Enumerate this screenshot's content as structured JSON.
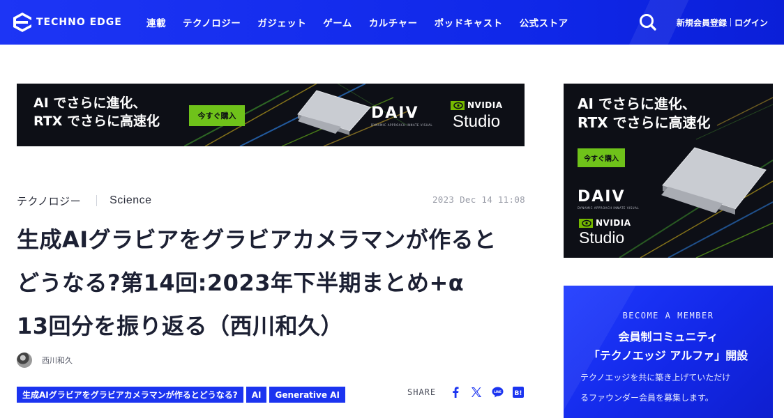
{
  "header": {
    "logo_text": "TECHNO EDGE",
    "nav": [
      "連載",
      "テクノロジー",
      "ガジェット",
      "ゲーム",
      "カルチャー",
      "ポッドキャスト",
      "公式ストア"
    ],
    "register_label": "新規会員登録",
    "login_label": "ログイン"
  },
  "ads": {
    "headline_line1": "AI でさらに進化、",
    "headline_line2": "RTX でさらに高速化",
    "button_label": "今すぐ購入",
    "brand": "DAIV",
    "brand_tagline": "DYNAMIC APPROACH INNATE VISUAL",
    "gpu_brand": "NVIDIA",
    "gpu_product": "Studio"
  },
  "article": {
    "categories": [
      "テクノロジー",
      "Science"
    ],
    "date": "2023 Dec 14 11:08",
    "title_lines": [
      "生成AIグラビアをグラビアカメラマンが作ると",
      "どうなる?第14回:2023年下半期まとめ+α",
      "13回分を振り返る（西川和久）"
    ],
    "author": "西川和久",
    "tags": [
      "生成AIグラビアをグラビアカメラマンが作るとどうなる?",
      "AI",
      "Generative AI"
    ],
    "share_label": "SHARE"
  },
  "membership": {
    "kicker": "BECOME A MEMBER",
    "title_line1": "会員制コミュニティ",
    "title_line2": "「テクノエッジ アルファ」開設",
    "desc_line1": "テクノエッジを共に築き上げていただけ",
    "desc_line2": "るファウンダー会員を募集します。"
  },
  "colors": {
    "brand_blue": "#1b34f0",
    "ad_green": "#6fc21a",
    "ad_bg": "#0d0f16"
  }
}
